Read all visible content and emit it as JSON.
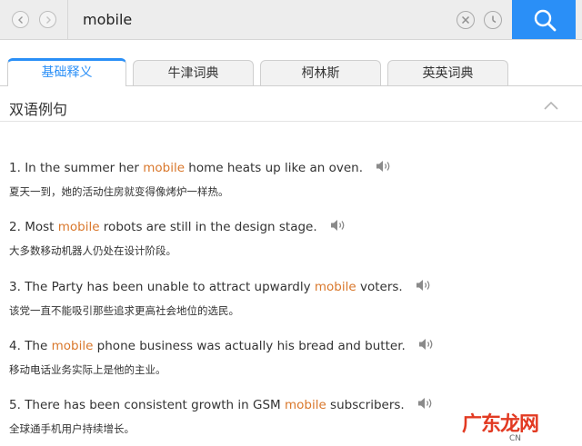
{
  "search": {
    "query": "mobile"
  },
  "tabs": [
    {
      "label": "基础释义",
      "active": true
    },
    {
      "label": "牛津词典",
      "active": false
    },
    {
      "label": "柯林斯",
      "active": false
    },
    {
      "label": "英英词典",
      "active": false
    }
  ],
  "section": {
    "title": "双语例句"
  },
  "examples": [
    {
      "num": "1.",
      "before": "In the summer her ",
      "keyword": "mobile",
      "after": " home heats up like an oven.",
      "cn": "夏天一到，她的活动住房就变得像烤炉一样热。"
    },
    {
      "num": "2.",
      "before": "Most ",
      "keyword": "mobile",
      "after": " robots are still in the design stage.",
      "cn": "大多数移动机器人仍处在设计阶段。"
    },
    {
      "num": "3.",
      "before": "The Party has been unable to attract upwardly ",
      "keyword": "mobile",
      "after": " voters.",
      "cn": "该党一直不能吸引那些追求更高社会地位的选民。"
    },
    {
      "num": "4.",
      "before": "The ",
      "keyword": "mobile",
      "after": " phone business was actually his bread and butter.",
      "cn": "移动电话业务实际上是他的主业。"
    },
    {
      "num": "5.",
      "before": "There has been consistent growth in GSM ",
      "keyword": "mobile",
      "after": " subscribers.",
      "cn": "全球通手机用户持续增长。"
    }
  ],
  "watermark": {
    "text": "广东龙网",
    "site": "CN"
  },
  "colors": {
    "accent": "#2a8ff7",
    "keyword": "#d9772b",
    "watermark": "#e23a22"
  }
}
